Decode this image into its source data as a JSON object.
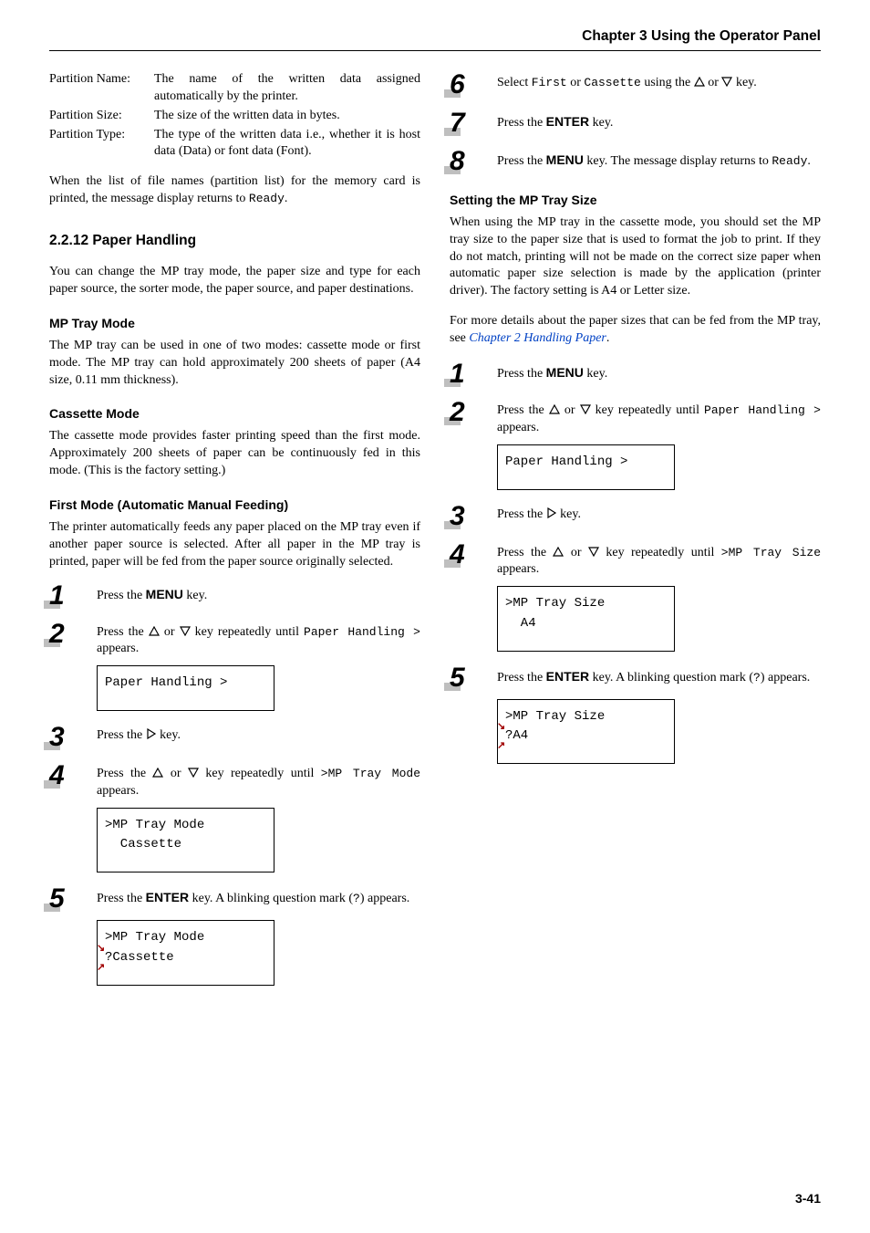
{
  "page": {
    "chapter_header": "Chapter 3  Using the Operator Panel",
    "footer": "3-41"
  },
  "defs": {
    "pname_label": "Partition Name:",
    "pname_val": "The name of the written data assigned automatically by the printer.",
    "psize_label": "Partition Size:",
    "psize_val": "The size of the written data in bytes.",
    "ptype_label": "Partition Type:",
    "ptype_val": "The type of the written data i.e., whether it is host data (Data) or font data (Font)."
  },
  "left": {
    "para_list": "When the list of file names (partition list) for the memory card is printed, the message display returns to ",
    "ready": "Ready",
    "h2": "2.2.12 Paper Handling",
    "intro": "You can change the MP tray mode, the paper size and type for each paper source, the sorter mode, the paper source, and paper destinations.",
    "h3_mp": "MP Tray Mode",
    "mp_body": "The MP tray can be used in one of two modes: cassette mode or first mode. The MP tray can hold approximately 200 sheets of paper (A4 size, 0.11 mm thickness).",
    "h3_cass": "Cassette Mode",
    "cass_body": "The cassette mode provides faster printing speed than the first mode. Approximately 200 sheets of paper can be continuously fed in this mode. (This is the factory setting.)",
    "h3_first": "First Mode (Automatic Manual Feeding)",
    "first_body": "The printer automatically feeds any paper placed on the MP tray even if another paper source is selected. After all paper in the MP tray is printed, paper will be fed from the paper source originally selected.",
    "s1": "Press the ",
    "menu_key": "MENU",
    "key_suffix": " key.",
    "s2a": "Press the ",
    "s2b": " or ",
    "s2c": " key repeatedly until ",
    "paper_handling": "Paper Handling >",
    "appears_after": " appears.",
    "disp1": "Paper Handling >",
    "s3a": "Press the ",
    "s3b": " key.",
    "s4a": "Press the ",
    "s4b": " or ",
    "s4c": " key repeatedly until ",
    "mp_tray_mode": ">MP  Tray Mode",
    "s4d": " appears.",
    "disp2_l1": ">MP Tray Mode",
    "disp2_l2": "  Cassette",
    "s5a": "Press the ",
    "enter_key": "ENTER",
    "s5b": " key. A blinking question mark (",
    "qmark": "?",
    "s5c": ") appears.",
    "disp3_l1": ">MP Tray Mode",
    "disp3_l2": "Cassette",
    "disp3_q": "? "
  },
  "right": {
    "s6a": "Select ",
    "first": "First",
    "s6b": " or ",
    "cassette": "Cassette",
    "s6c": " using the ",
    "s6d": " or ",
    "s6e": " key.",
    "s7a": "Press the ",
    "enter_key": "ENTER",
    "s7b": " key.",
    "s8a": "Press the ",
    "menu_key": "MENU",
    "s8b": " key. The message display returns to ",
    "ready": "Ready",
    "h3_setsize": "Setting the MP Tray Size",
    "setsize_para": "When using the MP tray in the cassette mode, you should set the MP tray size to the paper size that is used to format the job to print. If they do not match, printing will not be made on the correct size paper when automatic paper size selection is made by the application (printer driver). The factory setting is A4 or Letter size.",
    "more_a": "For more details about the paper sizes that can be fed from the MP tray, see ",
    "more_link": "Chapter 2 Handling Paper",
    "rs1a": "Press the ",
    "rs2a": "Press the ",
    "rs2b": " or ",
    "rs2c": " key repeatedly until ",
    "paper_handling2": "Paper Handling >",
    "rs2d": " appears.",
    "disp_r1": "Paper Handling >",
    "rs3a": "Press the ",
    "rs3b": " key.",
    "rs4a": "Press the ",
    "rs4b": " or ",
    "rs4c": " key repeatedly until ",
    "mp_tray_size": ">MP  Tray Size",
    "rs4d": " appears.",
    "disp_r2_l1": ">MP Tray Size",
    "disp_r2_l2": "  A4",
    "rs5a": "Press the ",
    "rs5b": " key. A blinking question mark (",
    "rs5c": ") appears.",
    "disp_r3_l1": ">MP Tray Size",
    "disp_r3_q": "? ",
    "disp_r3_l2": "A4"
  },
  "nums": {
    "n1": "1",
    "n2": "2",
    "n3": "3",
    "n4": "4",
    "n5": "5",
    "n6": "6",
    "n7": "7",
    "n8": "8"
  }
}
